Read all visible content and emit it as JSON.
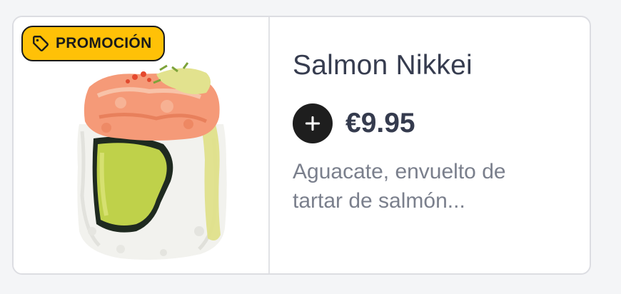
{
  "product": {
    "badge": {
      "label": "PROMOCIÓN",
      "icon": "tag-icon",
      "color": "#ffc107"
    },
    "image": "sushi-roll-image",
    "title": "Salmon Nikkei",
    "price": "€9.95",
    "add_icon": "plus-icon",
    "description": "Aguacate, envuelto de tartar de salmón..."
  }
}
